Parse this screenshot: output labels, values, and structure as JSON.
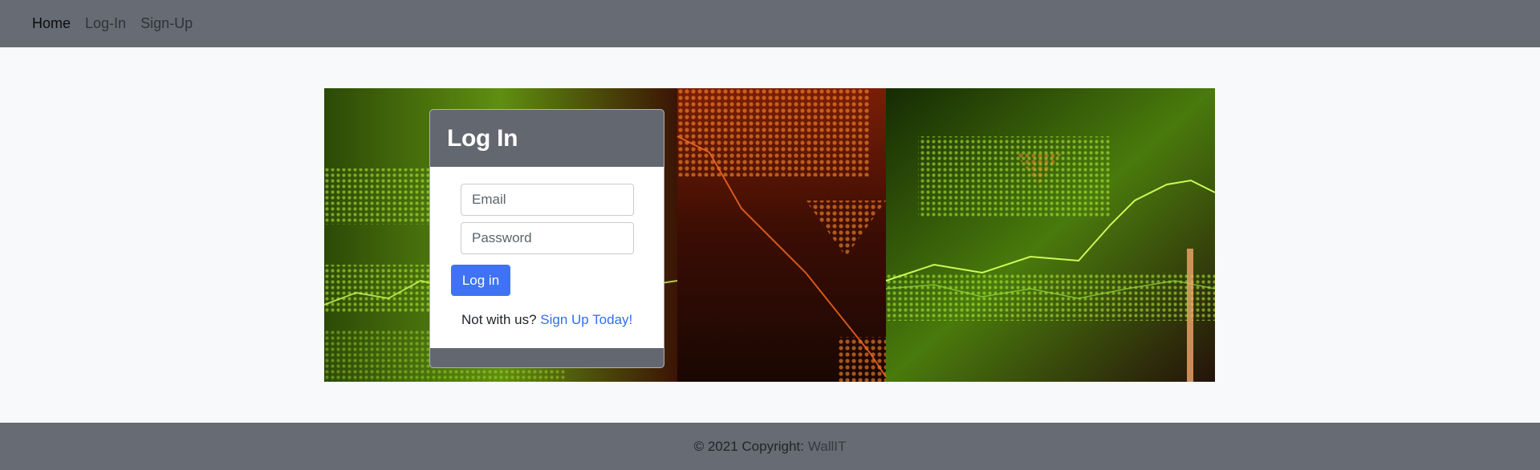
{
  "nav": {
    "items": [
      {
        "label": "Home",
        "active": true
      },
      {
        "label": "Log-In",
        "active": false
      },
      {
        "label": "Sign-Up",
        "active": false
      }
    ]
  },
  "hero": {
    "image": "stock-market-ticker-image"
  },
  "login": {
    "title": "Log In",
    "email_placeholder": "Email",
    "password_placeholder": "Password",
    "submit_label": "Log in",
    "signup_prompt": "Not with us?",
    "signup_link": "Sign Up Today!"
  },
  "footer": {
    "copyright": "© 2021 Copyright:",
    "brand": "WallIT"
  },
  "colors": {
    "navbar": "#676b74",
    "primary": "#3f73f4",
    "link": "#2f6ef2",
    "page_bg": "#f8f9fa"
  }
}
